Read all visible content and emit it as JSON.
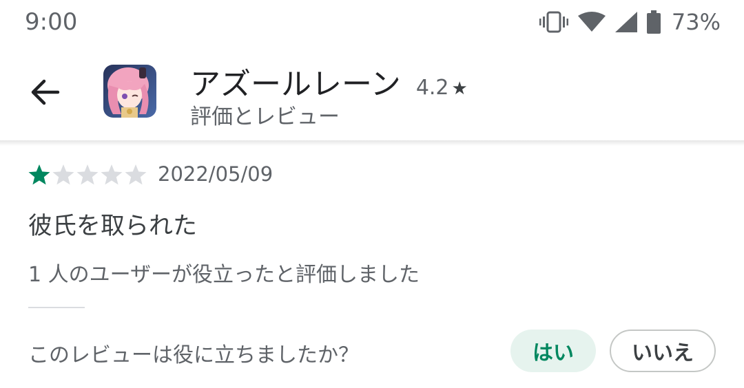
{
  "status_bar": {
    "time": "9:00",
    "battery": "73%",
    "icons": [
      "vibrate-icon",
      "wifi-icon",
      "cell-signal-icon",
      "battery-icon"
    ]
  },
  "header": {
    "back_icon": "arrow-back-icon",
    "app_name": "アズールレーン",
    "rating": "4.2",
    "rating_star": "★",
    "subtitle": "評価とレビュー"
  },
  "review": {
    "stars_filled": 1,
    "stars_total": 5,
    "date": "2022/05/09",
    "text": "彼氏を取られた",
    "helpful_count_text": "1 人のユーザーが役立ったと評価しました"
  },
  "feedback": {
    "question": "このレビューは役に立ちましたか？",
    "yes_label": "はい",
    "no_label": "いいえ"
  },
  "colors": {
    "accent_green": "#01875f",
    "yes_bg": "#e6f3ee",
    "star_empty": "#dadce0",
    "text_secondary": "#5f6368"
  }
}
